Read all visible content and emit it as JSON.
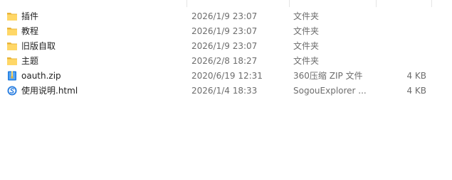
{
  "files": [
    {
      "name": "插件",
      "modified": "2026/1/9 23:07",
      "type": "文件夹",
      "size": "",
      "icon": "folder-icon"
    },
    {
      "name": "教程",
      "modified": "2026/1/9 23:07",
      "type": "文件夹",
      "size": "",
      "icon": "folder-icon"
    },
    {
      "name": "旧版自取",
      "modified": "2026/1/9 23:07",
      "type": "文件夹",
      "size": "",
      "icon": "folder-icon"
    },
    {
      "name": "主题",
      "modified": "2026/2/8 18:27",
      "type": "文件夹",
      "size": "",
      "icon": "folder-icon"
    },
    {
      "name": "oauth.zip",
      "modified": "2020/6/19 12:31",
      "type": "360压缩 ZIP 文件",
      "size": "4 KB",
      "icon": "zip-archive-icon"
    },
    {
      "name": "使用说明.html",
      "modified": "2026/1/4 18:33",
      "type": "SogouExplorer ...",
      "size": "4 KB",
      "icon": "sogou-browser-icon"
    }
  ],
  "colors": {
    "folder": "#ffd767",
    "folder_dark": "#e8b43a",
    "zip_blue": "#1f7be0",
    "sogou_blue": "#2b7fe0",
    "secondary_text": "#6d6d6d"
  }
}
